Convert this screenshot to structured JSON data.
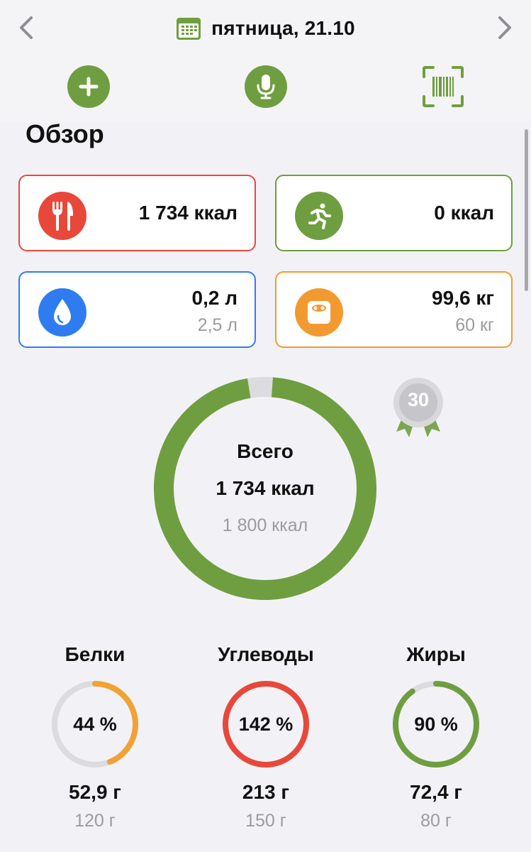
{
  "header": {
    "date": "пятница, 21.10",
    "icons": {
      "prev": "chevron-left-icon",
      "next": "chevron-right-icon",
      "calendar": "calendar-icon",
      "add": "plus-icon",
      "voice": "microphone-icon",
      "scan": "barcode-scan-icon"
    }
  },
  "overview": {
    "title": "Обзор",
    "cards": {
      "food": {
        "value": "1 734 ккал",
        "icon": "fork-knife-icon",
        "color": "#e8483a"
      },
      "activity": {
        "value": "0 ккал",
        "icon": "running-icon",
        "color": "#6f9e40"
      },
      "water": {
        "value": "0,2 л",
        "goal": "2,5 л",
        "icon": "water-drop-icon",
        "color": "#2f7cf0"
      },
      "weight": {
        "value": "99,6 кг",
        "goal": "60 кг",
        "icon": "scale-icon",
        "color": "#f29a30"
      }
    }
  },
  "total": {
    "label": "Всего",
    "value": "1 734 ккал",
    "goal": "1 800 ккал",
    "progress": 0.963,
    "color": "#6f9e40",
    "medal": "30"
  },
  "macros": [
    {
      "name": "Белки",
      "percent": "44 %",
      "fraction": 0.44,
      "amount": "52,9 г",
      "goal": "120 г",
      "color": "#f2a235"
    },
    {
      "name": "Углеводы",
      "percent": "142 %",
      "fraction": 1.0,
      "amount": "213 г",
      "goal": "150 г",
      "color": "#e8483a"
    },
    {
      "name": "Жиры",
      "percent": "90 %",
      "fraction": 0.9,
      "amount": "72,4 г",
      "goal": "80 г",
      "color": "#6f9e40"
    }
  ]
}
